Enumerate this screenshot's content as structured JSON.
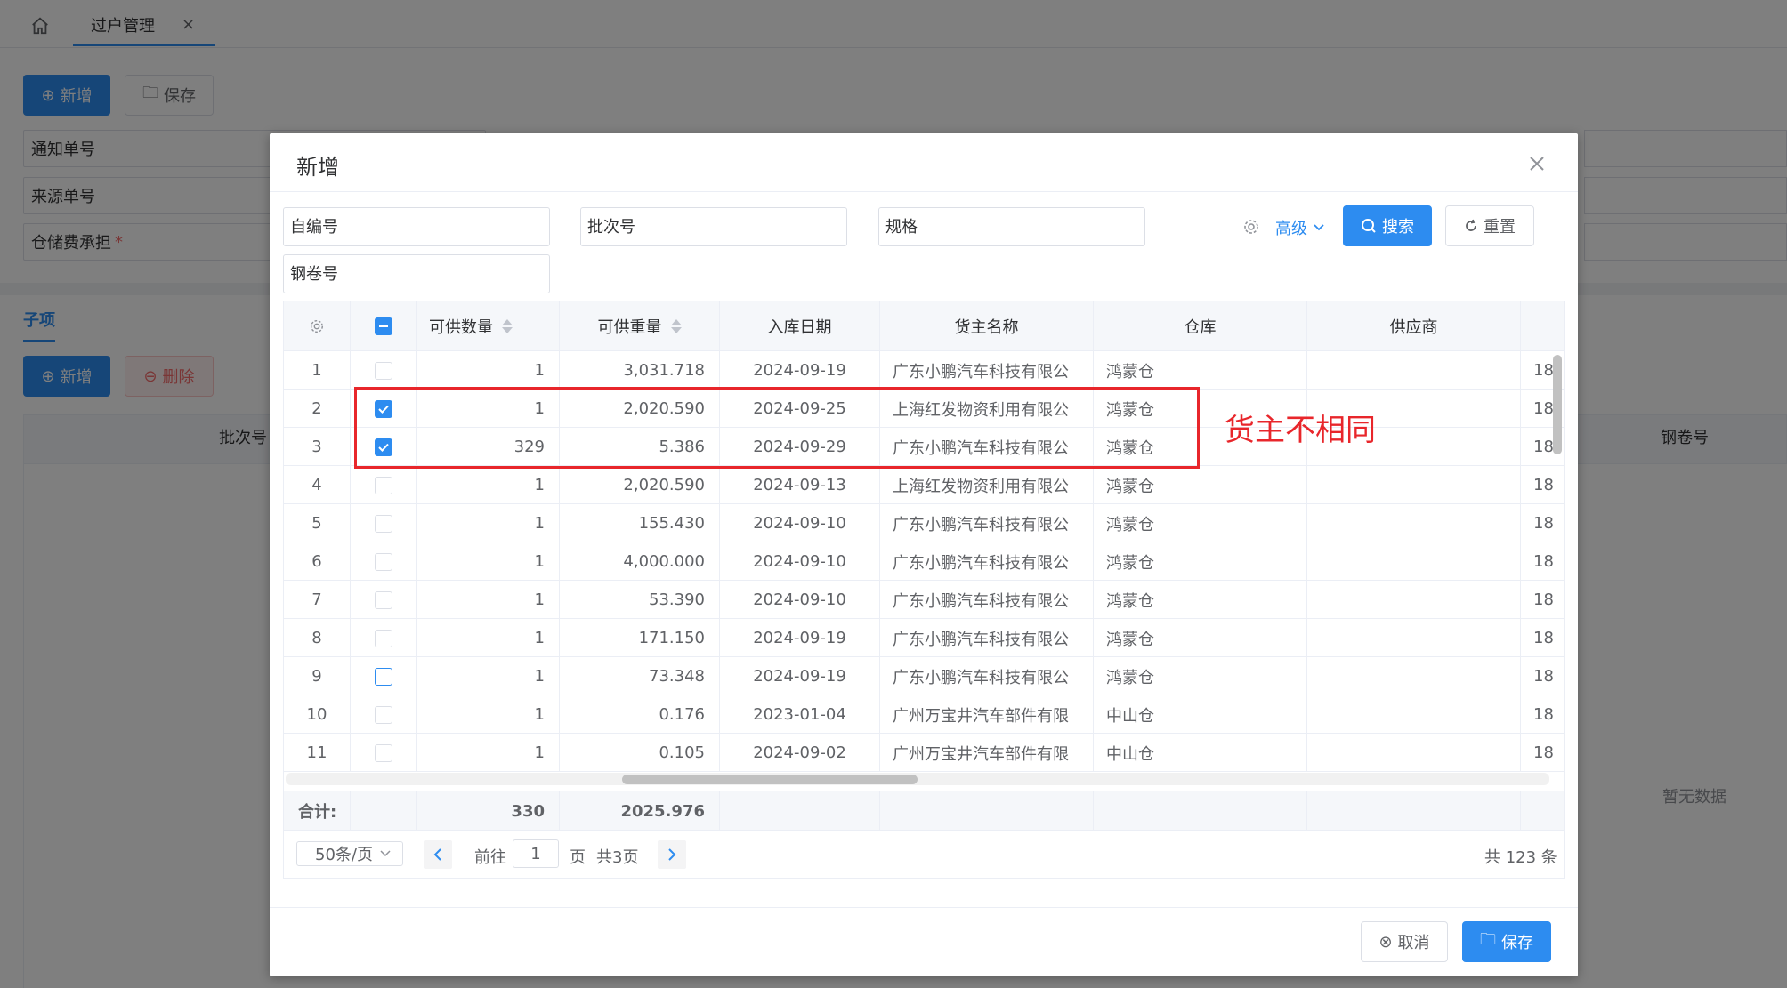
{
  "topbar": {
    "tab_label": "过户管理",
    "tab_close": "×"
  },
  "page": {
    "add_label": "新增",
    "save_label": "保存",
    "fields": [
      "通知单号",
      "来源单号",
      "仓储费承担"
    ],
    "required_mark": "*",
    "sub_tab": "子项",
    "sub_add_label": "新增",
    "sub_delete_label": "删除",
    "grid_cols": {
      "batch": "批次号",
      "coil": "钢卷号"
    },
    "empty_text": "暂无数据"
  },
  "dialog": {
    "title": "新增",
    "search": {
      "placeholders": [
        "自编号",
        "批次号",
        "规格",
        "钢卷号"
      ],
      "advanced_label": "高级",
      "search_label": "搜索",
      "reset_label": "重置"
    },
    "table": {
      "headers": {
        "qty": "可供数量",
        "weight": "可供重量",
        "date": "入库日期",
        "owner": "货主名称",
        "warehouse": "仓库",
        "supplier": "供应商"
      },
      "rows": [
        {
          "idx": "1",
          "checked": false,
          "qty": "1",
          "weight": "3,031.718",
          "date": "2024-09-19",
          "owner": "广东小鹏汽车科技有限公",
          "warehouse": "鸿蒙仓",
          "supplier": "",
          "extra": "18"
        },
        {
          "idx": "2",
          "checked": true,
          "qty": "1",
          "weight": "2,020.590",
          "date": "2024-09-25",
          "owner": "上海红发物资利用有限公",
          "warehouse": "鸿蒙仓",
          "supplier": "",
          "extra": "18"
        },
        {
          "idx": "3",
          "checked": true,
          "qty": "329",
          "weight": "5.386",
          "date": "2024-09-29",
          "owner": "广东小鹏汽车科技有限公",
          "warehouse": "鸿蒙仓",
          "supplier": "",
          "extra": "18"
        },
        {
          "idx": "4",
          "checked": false,
          "qty": "1",
          "weight": "2,020.590",
          "date": "2024-09-13",
          "owner": "上海红发物资利用有限公",
          "warehouse": "鸿蒙仓",
          "supplier": "",
          "extra": "18"
        },
        {
          "idx": "5",
          "checked": false,
          "qty": "1",
          "weight": "155.430",
          "date": "2024-09-10",
          "owner": "广东小鹏汽车科技有限公",
          "warehouse": "鸿蒙仓",
          "supplier": "",
          "extra": "18"
        },
        {
          "idx": "6",
          "checked": false,
          "qty": "1",
          "weight": "4,000.000",
          "date": "2024-09-10",
          "owner": "广东小鹏汽车科技有限公",
          "warehouse": "鸿蒙仓",
          "supplier": "",
          "extra": "18"
        },
        {
          "idx": "7",
          "checked": false,
          "qty": "1",
          "weight": "53.390",
          "date": "2024-09-10",
          "owner": "广东小鹏汽车科技有限公",
          "warehouse": "鸿蒙仓",
          "supplier": "",
          "extra": "18"
        },
        {
          "idx": "8",
          "checked": false,
          "qty": "1",
          "weight": "171.150",
          "date": "2024-09-19",
          "owner": "广东小鹏汽车科技有限公",
          "warehouse": "鸿蒙仓",
          "supplier": "",
          "extra": "18"
        },
        {
          "idx": "9",
          "checked": false,
          "hover": true,
          "qty": "1",
          "weight": "73.348",
          "date": "2024-09-19",
          "owner": "广东小鹏汽车科技有限公",
          "warehouse": "鸿蒙仓",
          "supplier": "",
          "extra": "18"
        },
        {
          "idx": "10",
          "checked": false,
          "qty": "1",
          "weight": "0.176",
          "date": "2023-01-04",
          "owner": "广州万宝井汽车部件有限",
          "warehouse": "中山仓",
          "supplier": "",
          "extra": "18"
        },
        {
          "idx": "11",
          "checked": false,
          "qty": "1",
          "weight": "0.105",
          "date": "2024-09-02",
          "owner": "广州万宝井汽车部件有限",
          "warehouse": "中山仓",
          "supplier": "",
          "extra": "18"
        }
      ],
      "summary": {
        "label": "合计:",
        "qty": "330",
        "weight": "2025.976"
      }
    },
    "pager": {
      "page_size": "50条/页",
      "goto_label": "前往",
      "current_page": "1",
      "page_unit": "页",
      "total_pages": "共3页",
      "total_count": "共 123 条"
    },
    "footer": {
      "cancel_label": "取消",
      "save_label": "保存"
    }
  },
  "annotation": {
    "text": "货主不相同",
    "color": "#e8262b"
  },
  "colors": {
    "primary": "#2d8cf0",
    "danger": "#f56c6c"
  }
}
